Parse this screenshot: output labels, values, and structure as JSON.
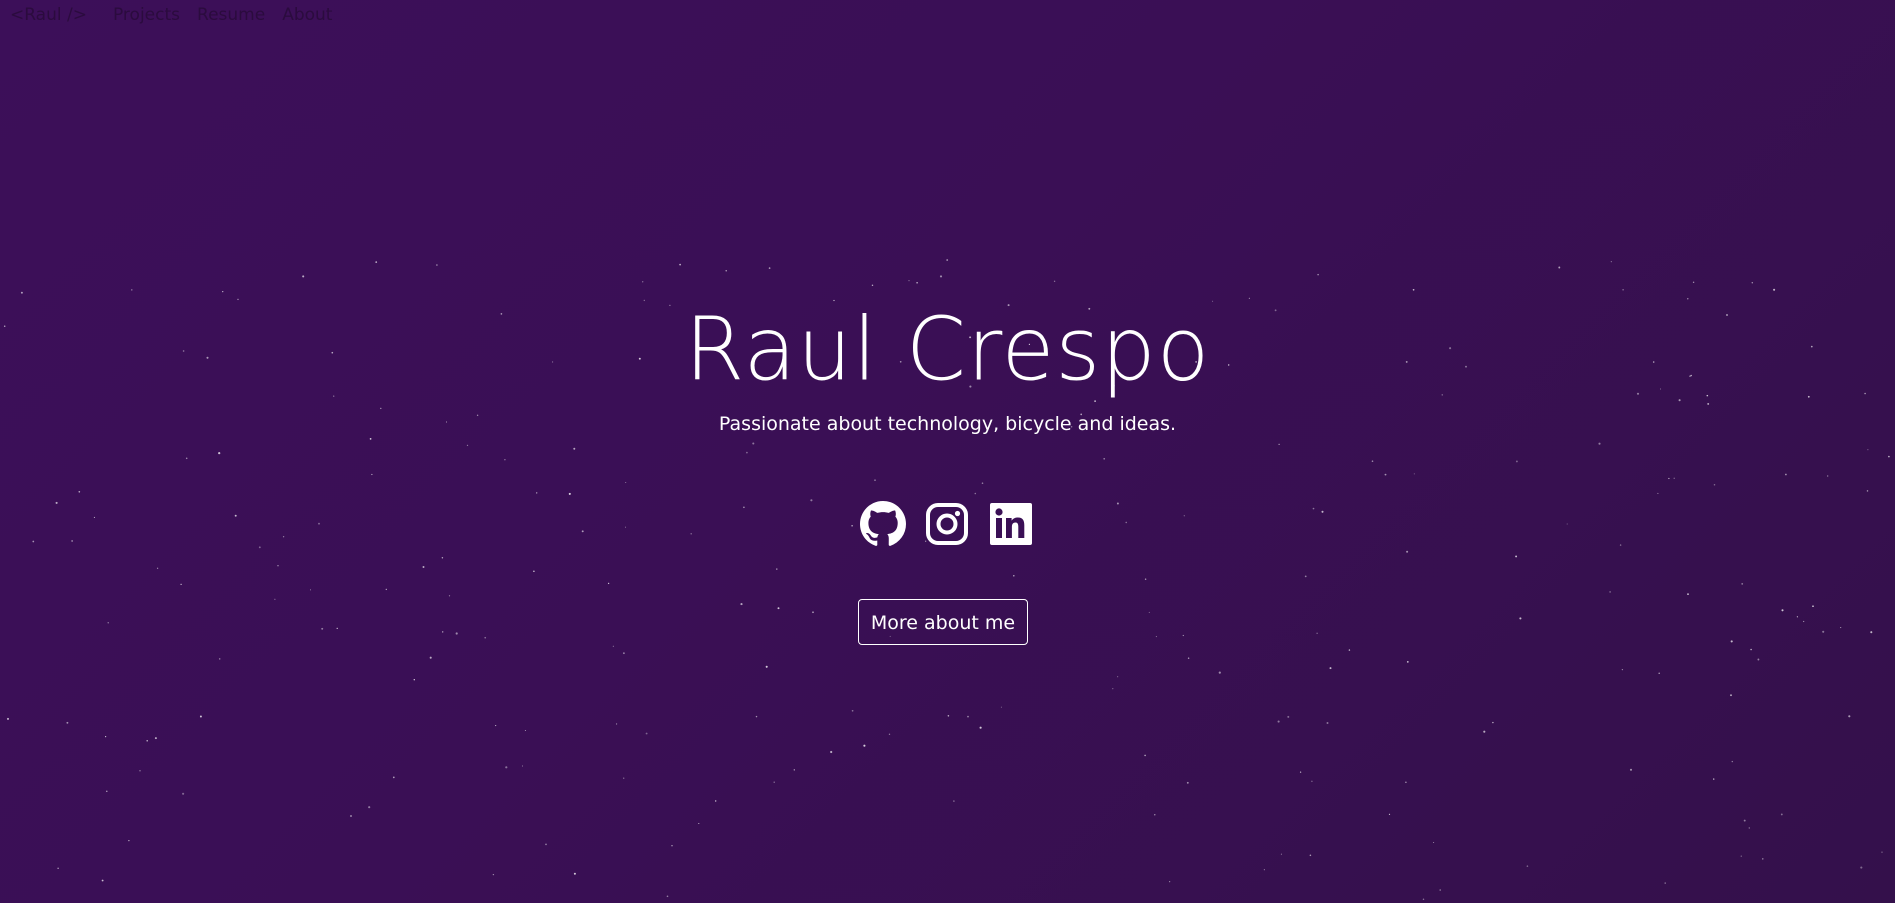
{
  "navbar": {
    "brand": "<Raul />",
    "links": [
      "Projects",
      "Resume",
      "About"
    ]
  },
  "hero": {
    "title": "Raul Crespo",
    "subtitle": "Passionate about technology, bicycle and ideas.",
    "cta_label": "More about me"
  },
  "social": [
    {
      "icon": "github-icon"
    },
    {
      "icon": "instagram-icon"
    },
    {
      "icon": "linkedin-icon"
    }
  ],
  "colors": {
    "background": "#3b0f57",
    "nav_text": "#2b0b3e",
    "text": "#ffffff"
  }
}
